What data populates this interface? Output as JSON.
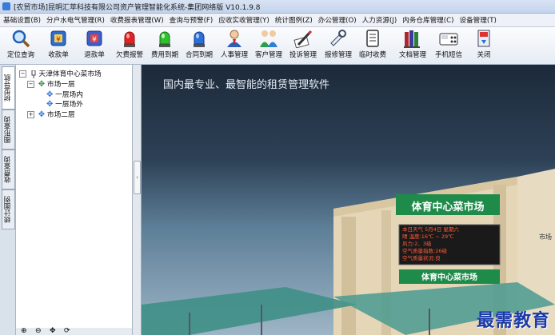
{
  "window": {
    "title": "[农贸市场]昆明汇苹科技有限公司资产管理智能化系统-集团网络版 V10.1.9.8"
  },
  "menu": [
    {
      "label": "基础设置(B)"
    },
    {
      "label": "分户水电气管理(R)"
    },
    {
      "label": "收费报表管理(W)"
    },
    {
      "label": "查询与预警(F)"
    },
    {
      "label": "应收实收管理(Y)"
    },
    {
      "label": "统计图例(Z)"
    },
    {
      "label": "办公管理(O)"
    },
    {
      "label": "人力资源(J)"
    },
    {
      "label": "内务仓库管理(C)"
    },
    {
      "label": "设备管理(T)"
    }
  ],
  "toolbar": [
    {
      "label": "定位查询",
      "icon": "magnifier-icon"
    },
    {
      "label": "收款单",
      "icon": "receipt-icon"
    },
    {
      "label": "退款单",
      "icon": "refund-icon"
    },
    {
      "label": "欠费报警",
      "icon": "red-alarm-icon"
    },
    {
      "label": "费用到期",
      "icon": "green-alarm-icon"
    },
    {
      "label": "合同到期",
      "icon": "blue-alarm-icon"
    },
    {
      "label": "人事管理",
      "icon": "person-icon"
    },
    {
      "label": "客户管理",
      "icon": "customers-icon"
    },
    {
      "label": "投诉管理",
      "icon": "pen-icon"
    },
    {
      "label": "报修管理",
      "icon": "tools-icon"
    },
    {
      "label": "临时收费",
      "icon": "notebook-icon"
    },
    {
      "label": "文档管理",
      "icon": "binders-icon"
    },
    {
      "label": "手机短信",
      "icon": "phone-icon"
    },
    {
      "label": "关闭",
      "icon": "exit-icon"
    }
  ],
  "sidetabs": [
    {
      "label": "树型导航"
    },
    {
      "label": "图形查询"
    },
    {
      "label": "收费查询"
    },
    {
      "label": "统计图例"
    }
  ],
  "tree": [
    {
      "label": "天津体育中心菜市场",
      "toggle": "⊟"
    },
    {
      "label": "市场一层",
      "toggle": "⊟"
    },
    {
      "label": "一层场内",
      "toggle": ""
    },
    {
      "label": "一层场外",
      "toggle": ""
    },
    {
      "label": "市场二层",
      "toggle": "⊞"
    }
  ],
  "main": {
    "slogan": "国内最专业、最智能的租赁管理软件",
    "sign_top": "体育中心菜市场",
    "sign_bottom": "体育中心菜市场",
    "led_lines": [
      "本日天气 5月4日 星期六",
      "晴 温度:16℃ ~ 29℃",
      "风力:2、3级",
      "空气质量指数:26级",
      "空气质量状况:良"
    ],
    "side_label": "市场",
    "watermark": "最需教育"
  }
}
